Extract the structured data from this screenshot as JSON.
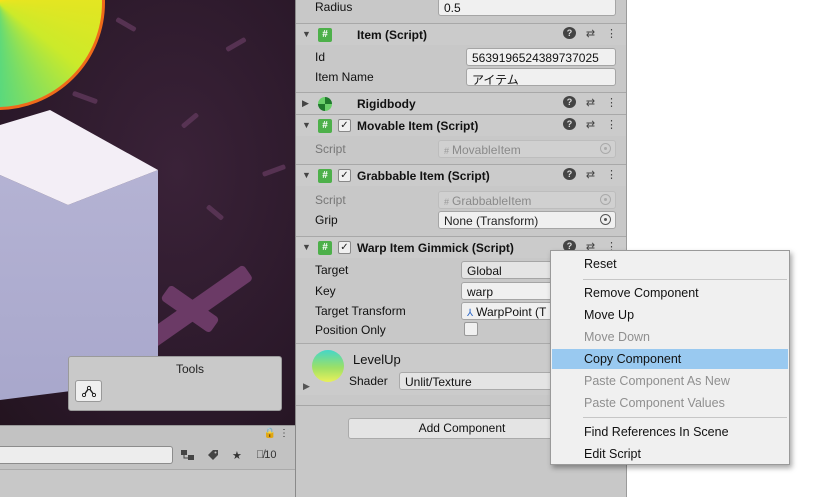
{
  "scene": {
    "tools_title": "Tools",
    "tool_icon": "path-tool-icon",
    "bottom": {
      "hidden_count": "10"
    }
  },
  "inspector": {
    "radius": {
      "label": "Radius",
      "value": "0.5"
    },
    "components": {
      "item": {
        "title": "Item (Script)",
        "id_label": "Id",
        "id_value": "5639196524389737025",
        "name_label": "Item Name",
        "name_value": "アイテム"
      },
      "rigidbody": {
        "title": "Rigidbody"
      },
      "movable": {
        "title": "Movable Item (Script)",
        "script_label": "Script",
        "script_value": "MovableItem"
      },
      "grabbable": {
        "title": "Grabbable Item (Script)",
        "script_label": "Script",
        "script_value": "GrabbableItem",
        "grip_label": "Grip",
        "grip_value": "None (Transform)"
      },
      "warp": {
        "title": "Warp Item Gimmick (Script)",
        "target_label": "Target",
        "target_value": "Global",
        "key_label": "Key",
        "key_value": "warp",
        "tt_label": "Target Transform",
        "tt_value": "WarpPoint (T",
        "po_label": "Position Only"
      }
    },
    "material": {
      "name": "LevelUp",
      "shader_label": "Shader",
      "shader_value": "Unlit/Texture"
    },
    "add_component": "Add Component"
  },
  "context_menu": {
    "items": [
      {
        "label": "Reset",
        "enabled": true
      },
      {
        "label": "Remove Component",
        "enabled": true
      },
      {
        "label": "Move Up",
        "enabled": true
      },
      {
        "label": "Move Down",
        "enabled": false
      },
      {
        "label": "Copy Component",
        "enabled": true,
        "highlighted": true
      },
      {
        "label": "Paste Component As New",
        "enabled": false
      },
      {
        "label": "Paste Component Values",
        "enabled": false
      },
      {
        "label": "Find References In Scene",
        "enabled": true
      },
      {
        "label": "Edit Script",
        "enabled": true
      }
    ]
  },
  "colors": {
    "highlight": "#99c9f0",
    "component_icon": "#4db04a",
    "inspector_bg": "#c8c8c8"
  }
}
